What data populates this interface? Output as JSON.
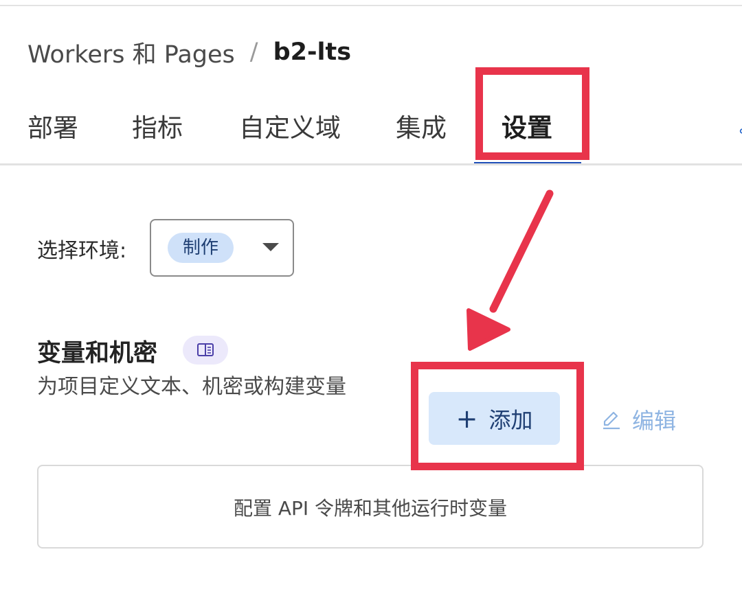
{
  "breadcrumb": {
    "parent": "Workers 和 Pages",
    "separator": "/",
    "current": "b2-lts"
  },
  "tabs": [
    {
      "label": "部署"
    },
    {
      "label": "指标"
    },
    {
      "label": "自定义域"
    },
    {
      "label": "集成"
    },
    {
      "label": "设置",
      "active": true
    }
  ],
  "environment": {
    "label": "选择环境:",
    "selected": "制作"
  },
  "variables_section": {
    "title": "变量和机密",
    "description": "为项目定义文本、机密或构建变量",
    "add_label": "添加",
    "edit_label": "编辑",
    "empty_text": "配置 API 令牌和其他运行时变量"
  },
  "icons": {
    "doc_badge": "book-icon",
    "add": "plus-icon",
    "edit": "pencil-icon",
    "env_dropdown": "caret-down-icon"
  },
  "colors": {
    "annotation": "#e8344b",
    "active_tab_underline": "#1f4fb8",
    "env_pill": "#cfe1f9",
    "add_button": "#d8e8fb",
    "edit_link": "#8eb4e2"
  }
}
